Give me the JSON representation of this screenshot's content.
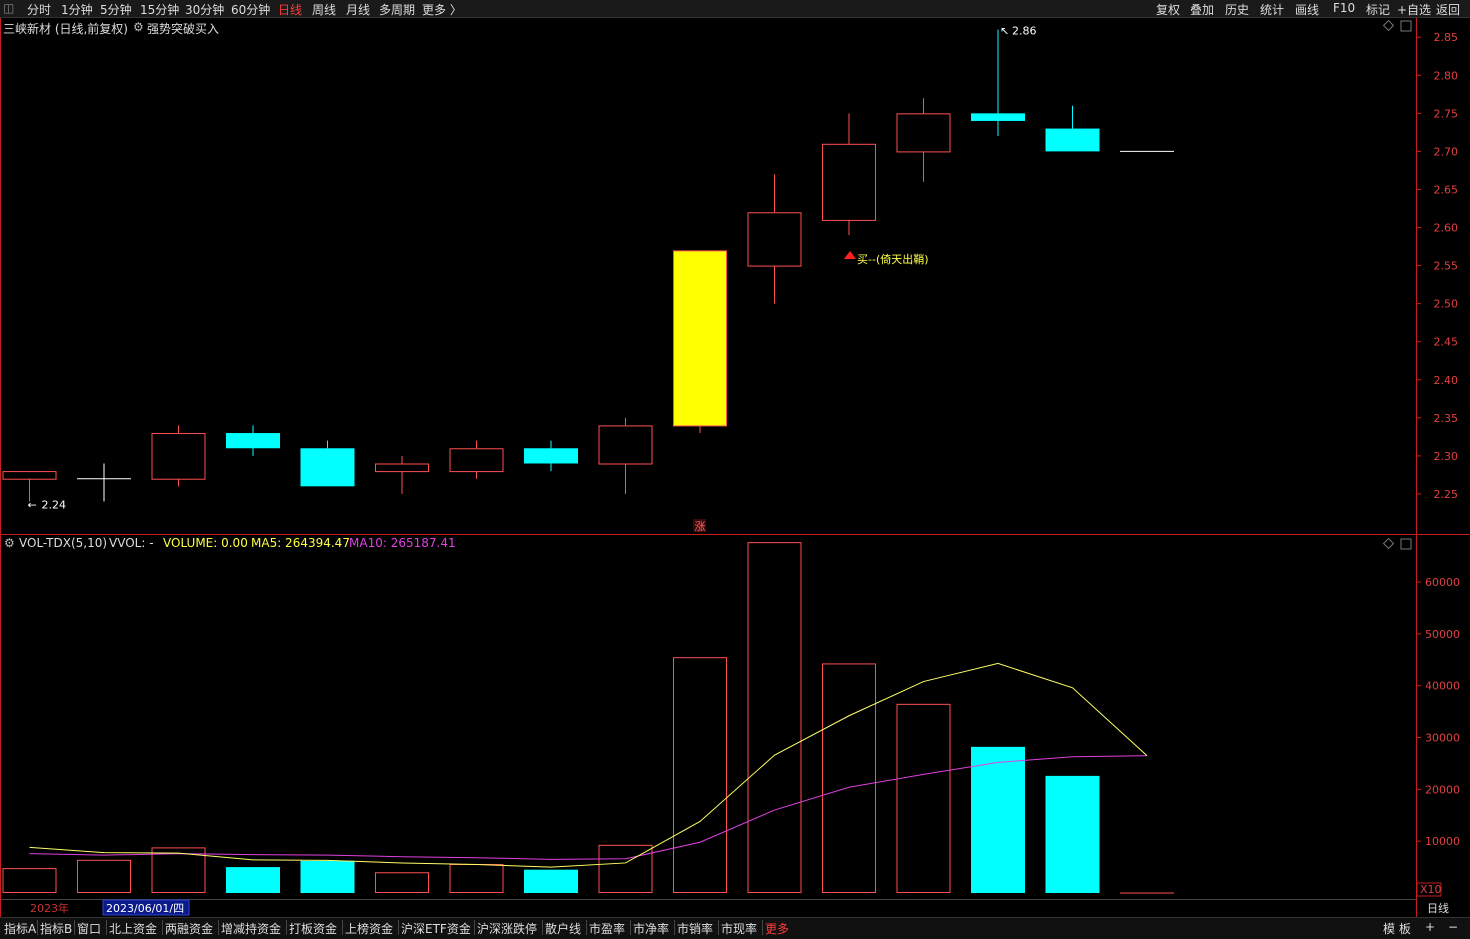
{
  "top_toolbar": {
    "periods": [
      "分时",
      "1分钟",
      "5分钟",
      "15分钟",
      "30分钟",
      "60分钟",
      "日线",
      "周线",
      "月线",
      "多周期",
      "更多 〉"
    ],
    "active_period": "日线",
    "right_buttons": [
      "复权",
      "叠加",
      "历史",
      "统计",
      "画线",
      "F10",
      "标记",
      "+自选",
      "返回"
    ]
  },
  "title": {
    "stock": "三峡新材 (日线,前复权)",
    "formula": "强势突破买入"
  },
  "indicator": {
    "name": "VOL-TDX(5,10)",
    "vvol": "VVOL: -",
    "volume": "VOLUME: 0.00",
    "ma5": "MA5: 264394.47",
    "ma10": "MA10: 265187.41",
    "unit": "X10"
  },
  "annotations": {
    "high": "2.86",
    "low": "2.24",
    "buy": "买--(倚天出鞘)",
    "mark": "涨"
  },
  "date_bar": {
    "year": "2023年",
    "date": "2023/06/01/四",
    "period": "日线"
  },
  "bottom_tabs": [
    "指标A",
    "指标B",
    "窗口",
    "北上资金",
    "两融资金",
    "增减持资金",
    "打板资金",
    "上榜资金",
    "沪深ETF资金",
    "沪深涨跌停",
    "散户线",
    "市盈率",
    "市净率",
    "市销率",
    "市现率",
    "更多"
  ],
  "bottom_right": [
    "模 板",
    "+",
    "−"
  ],
  "colors": {
    "up": "#ff5050",
    "down": "#00ffff",
    "limit_up": "#ffff00",
    "ma5": "#ffff66",
    "ma10": "#e040e0",
    "axis": "#c81e1e"
  },
  "chart_data": [
    {
      "type": "candlestick",
      "y_ticks": [
        2.25,
        2.3,
        2.35,
        2.4,
        2.45,
        2.5,
        2.55,
        2.6,
        2.65,
        2.7,
        2.75,
        2.8,
        2.85
      ],
      "ylim": [
        2.2,
        2.87
      ],
      "candles": [
        {
          "o": 2.27,
          "h": 2.28,
          "l": 2.24,
          "c": 2.28
        },
        {
          "o": 2.27,
          "h": 2.29,
          "l": 2.24,
          "c": 2.27
        },
        {
          "o": 2.27,
          "h": 2.34,
          "l": 2.26,
          "c": 2.33
        },
        {
          "o": 2.33,
          "h": 2.34,
          "l": 2.3,
          "c": 2.31
        },
        {
          "o": 2.31,
          "h": 2.32,
          "l": 2.26,
          "c": 2.26
        },
        {
          "o": 2.28,
          "h": 2.3,
          "l": 2.25,
          "c": 2.29
        },
        {
          "o": 2.28,
          "h": 2.32,
          "l": 2.27,
          "c": 2.31
        },
        {
          "o": 2.31,
          "h": 2.32,
          "l": 2.28,
          "c": 2.29
        },
        {
          "o": 2.29,
          "h": 2.35,
          "l": 2.25,
          "c": 2.34
        },
        {
          "o": 2.34,
          "h": 2.57,
          "l": 2.33,
          "c": 2.57
        },
        {
          "o": 2.55,
          "h": 2.67,
          "l": 2.5,
          "c": 2.62
        },
        {
          "o": 2.61,
          "h": 2.75,
          "l": 2.59,
          "c": 2.71
        },
        {
          "o": 2.7,
          "h": 2.77,
          "l": 2.66,
          "c": 2.75
        },
        {
          "o": 2.75,
          "h": 2.86,
          "l": 2.72,
          "c": 2.74
        },
        {
          "o": 2.73,
          "h": 2.76,
          "l": 2.7,
          "c": 2.7
        },
        {
          "o": 2.7,
          "h": 2.7,
          "l": 2.7,
          "c": 2.7
        }
      ],
      "limit_up_index": 9
    },
    {
      "type": "bar",
      "y_ticks": [
        10000,
        20000,
        30000,
        40000,
        50000,
        60000
      ],
      "ylim": [
        0,
        68500
      ],
      "volumes": [
        4800,
        6400,
        8800,
        5000,
        6200,
        4000,
        5600,
        4500,
        9300,
        45500,
        67700,
        44300,
        36500,
        28200,
        22600,
        0
      ],
      "ma5": [
        8800,
        7800,
        7700,
        6400,
        6300,
        5800,
        5500,
        5000,
        5800,
        13800,
        26600,
        34200,
        40800,
        44300,
        39600,
        26500
      ],
      "ma10": [
        7600,
        7300,
        7600,
        7400,
        7300,
        7000,
        6800,
        6500,
        6600,
        9800,
        16000,
        20400,
        22900,
        25200,
        26300,
        26500
      ]
    }
  ]
}
